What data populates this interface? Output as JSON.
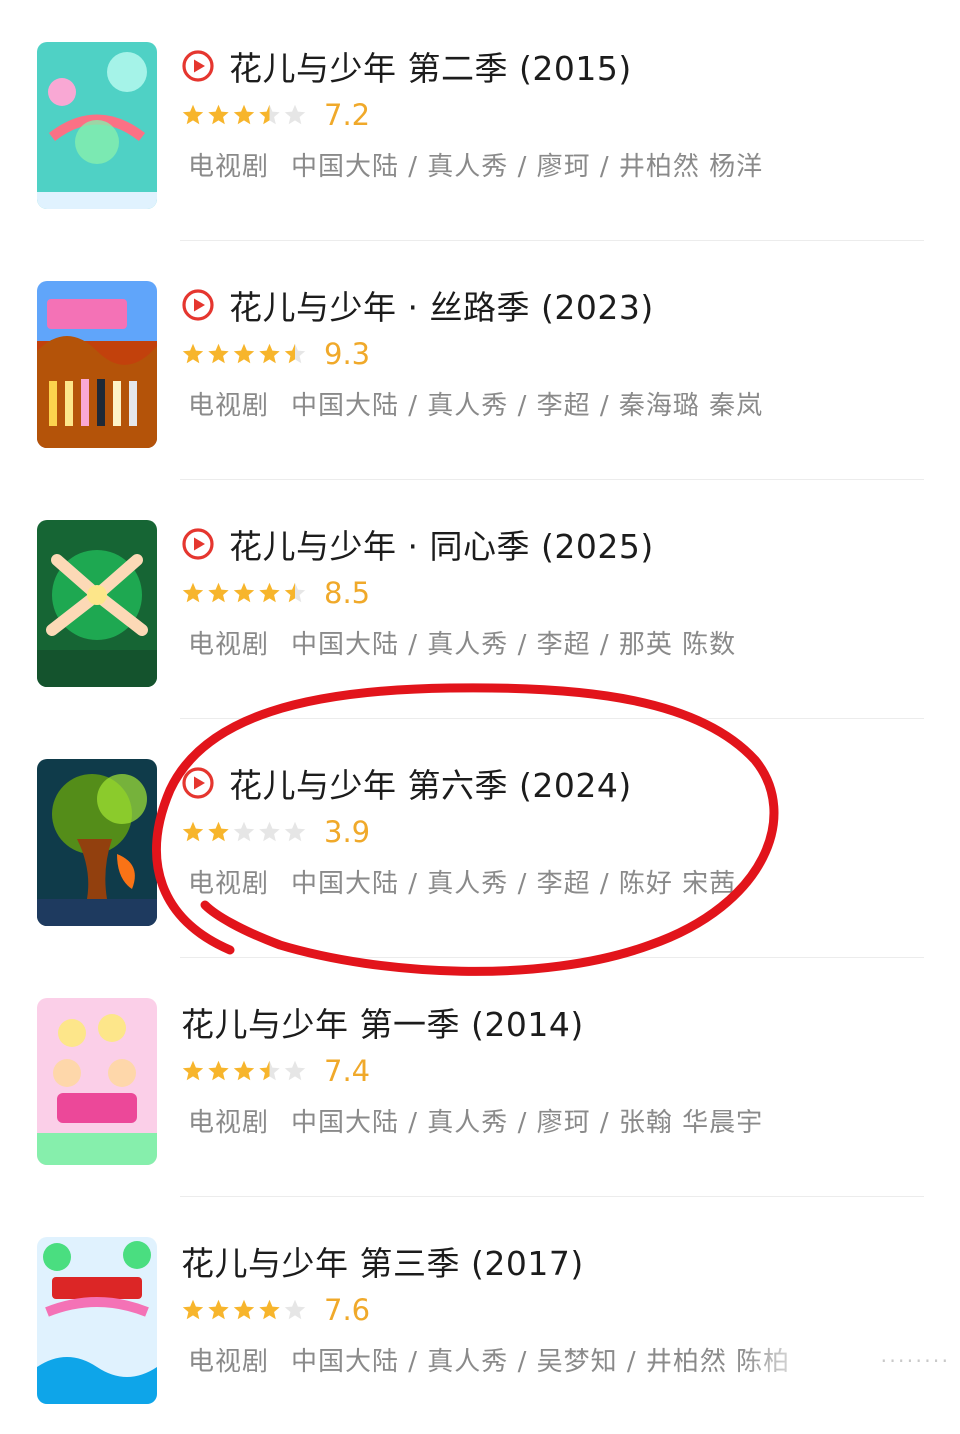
{
  "colors": {
    "star_filled": "#f7b52c",
    "star_empty": "#e6e6e6",
    "score": "#f0a92a",
    "play_icon": "#e5362f",
    "annotation": "#e2141b",
    "meta_text": "#8a8a8a",
    "title_text": "#1c1c1c"
  },
  "items": [
    {
      "title": "花儿与少年 第二季 (2015)",
      "has_play_icon": true,
      "stars": 3.5,
      "score": "7.2",
      "type": "电视剧",
      "meta": "中国大陆 / 真人秀 / 廖珂 / 井柏然 杨洋",
      "poster_icon": "poster-season-2-image"
    },
    {
      "title": "花儿与少年 · 丝路季 (2023)",
      "has_play_icon": true,
      "stars": 4.5,
      "score": "9.3",
      "type": "电视剧",
      "meta": "中国大陆 / 真人秀 / 李超 / 秦海璐 秦岚",
      "poster_icon": "poster-silk-road-image"
    },
    {
      "title": "花儿与少年 · 同心季 (2025)",
      "has_play_icon": true,
      "stars": 4.5,
      "score": "8.5",
      "type": "电视剧",
      "meta": "中国大陆 / 真人秀 / 李超 / 那英 陈数",
      "poster_icon": "poster-tongxin-image"
    },
    {
      "title": "花儿与少年 第六季 (2024)",
      "has_play_icon": true,
      "stars": 2,
      "score": "3.9",
      "type": "电视剧",
      "meta": "中国大陆 / 真人秀 / 李超 / 陈好 宋茜",
      "poster_icon": "poster-season-6-image"
    },
    {
      "title": "花儿与少年 第一季 (2014)",
      "has_play_icon": false,
      "stars": 3.5,
      "score": "7.4",
      "type": "电视剧",
      "meta": "中国大陆 / 真人秀 / 廖珂 / 张翰 华晨宇",
      "poster_icon": "poster-season-1-image"
    },
    {
      "title": "花儿与少年 第三季 (2017)",
      "has_play_icon": false,
      "stars": 4,
      "score": "7.6",
      "type": "电视剧",
      "meta": "中国大陆 / 真人秀 / 吴梦知 / 井柏然 陈柏",
      "poster_icon": "poster-season-3-image"
    }
  ]
}
